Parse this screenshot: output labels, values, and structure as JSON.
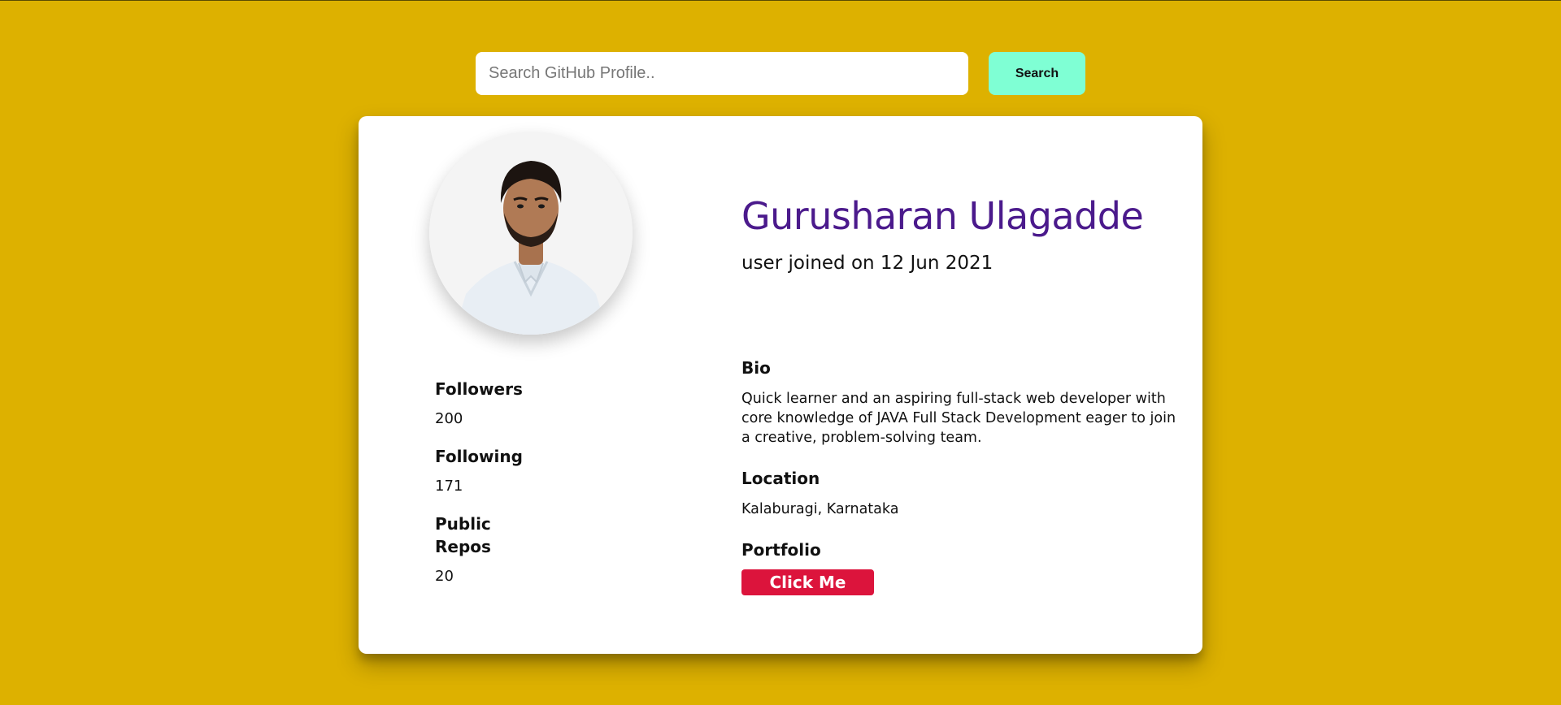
{
  "search": {
    "placeholder": "Search GitHub Profile..",
    "value": "",
    "button_label": "Search"
  },
  "profile": {
    "name": "Gurusharan Ulagadde",
    "joined": "user joined on 12 Jun 2021",
    "avatar_icon": "profile-photo"
  },
  "stats": {
    "followers_label": "Followers",
    "followers_value": "200",
    "following_label": "Following",
    "following_value": "171",
    "repos_label": "Public Repos",
    "repos_value": "20"
  },
  "info": {
    "bio_label": "Bio",
    "bio_text": "Quick learner and an aspiring full-stack web developer with core knowledge of JAVA Full Stack Development eager to join a creative, problem-solving team.",
    "location_label": "Location",
    "location_text": "Kalaburagi, Karnataka",
    "portfolio_label": "Portfolio",
    "portfolio_button": "Click Me"
  },
  "colors": {
    "background": "#ddb100",
    "name": "#4b1a8c",
    "search_button": "#7fffd4",
    "portfolio_button": "#dc143c"
  }
}
